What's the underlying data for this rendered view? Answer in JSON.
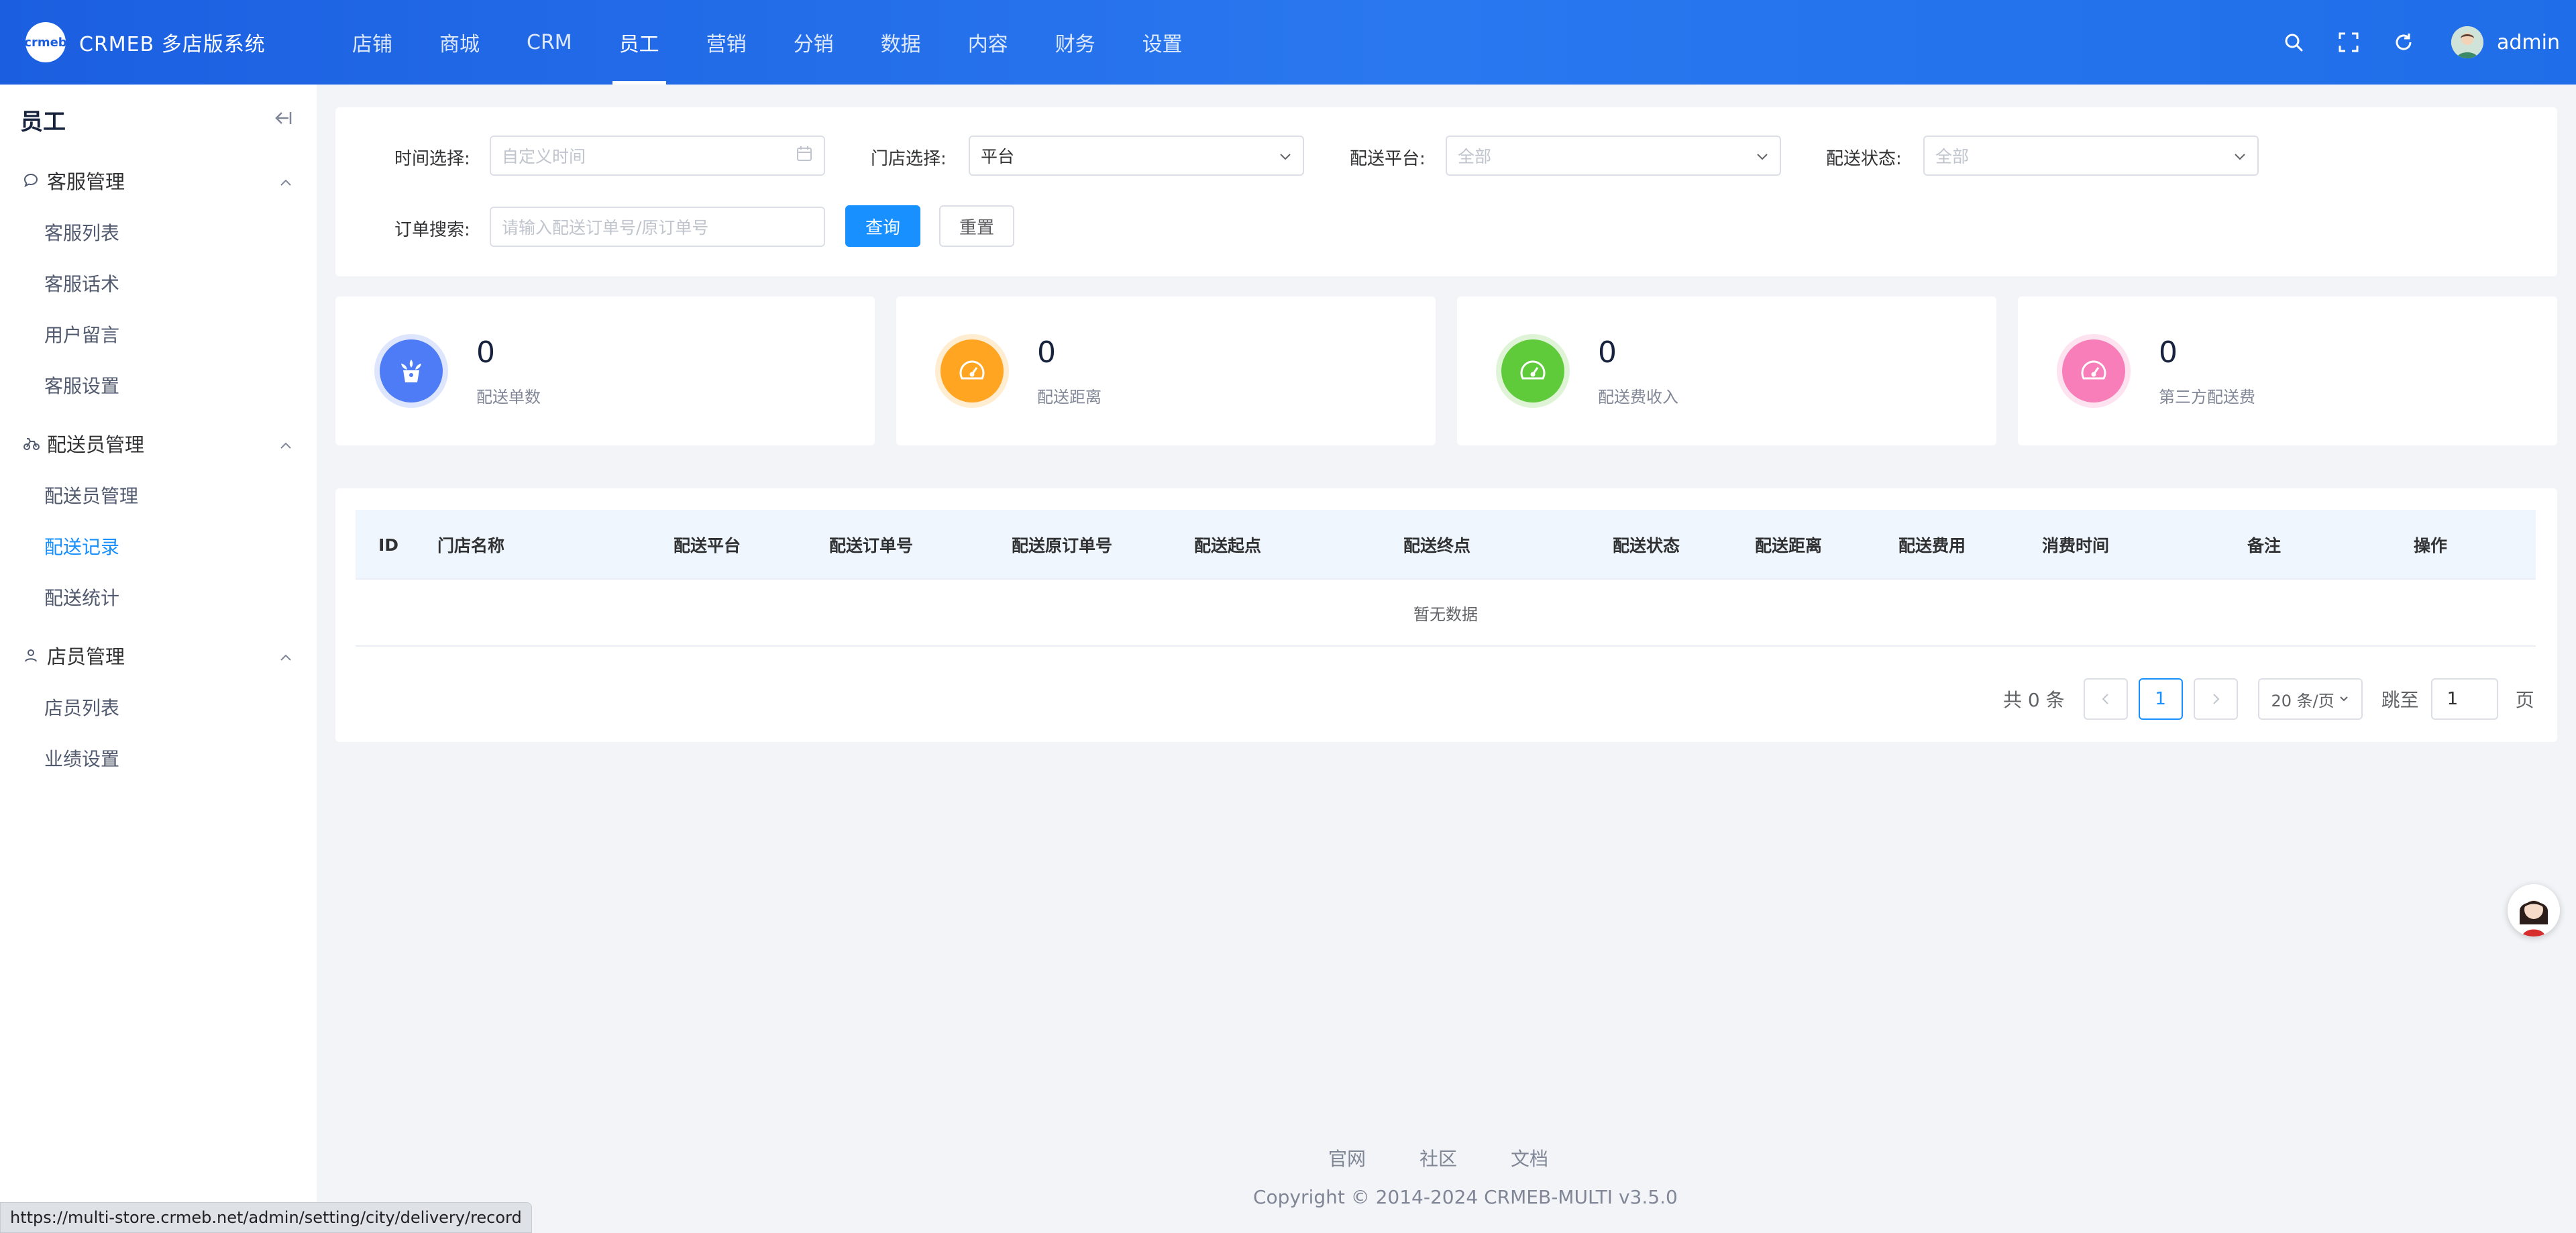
{
  "header": {
    "logo_text": "crmeb",
    "app_title": "CRMEB 多店版系统",
    "nav": [
      "店铺",
      "商城",
      "CRM",
      "员工",
      "营销",
      "分销",
      "数据",
      "内容",
      "财务",
      "设置"
    ],
    "active_nav": "员工",
    "username": "admin"
  },
  "sidebar": {
    "title": "员工",
    "groups": [
      {
        "title": "客服管理",
        "items": [
          "客服列表",
          "客服话术",
          "用户留言",
          "客服设置"
        ]
      },
      {
        "title": "配送员管理",
        "items": [
          "配送员管理",
          "配送记录",
          "配送统计"
        ]
      },
      {
        "title": "店员管理",
        "items": [
          "店员列表",
          "业绩设置"
        ]
      }
    ],
    "active_item": "配送记录"
  },
  "filters": {
    "time_label": "时间选择:",
    "time_placeholder": "自定义时间",
    "store_label": "门店选择:",
    "store_value": "平台",
    "platform_label": "配送平台:",
    "platform_placeholder": "全部",
    "status_label": "配送状态:",
    "status_placeholder": "全部",
    "search_label": "订单搜索:",
    "search_placeholder": "请输入配送订单号/原订单号",
    "query_button": "查询",
    "reset_button": "重置"
  },
  "stats": [
    {
      "value": "0",
      "label": "配送单数",
      "color": "#4e7cf6",
      "ring": "#dde6fd"
    },
    {
      "value": "0",
      "label": "配送距离",
      "color": "#ffa522",
      "ring": "#ffedd2"
    },
    {
      "value": "0",
      "label": "配送费收入",
      "color": "#5fcb3b",
      "ring": "#dff4d7"
    },
    {
      "value": "0",
      "label": "第三方配送费",
      "color": "#f77eb9",
      "ring": "#fde2ef"
    }
  ],
  "table": {
    "columns": [
      "ID",
      "门店名称",
      "配送平台",
      "配送订单号",
      "配送原订单号",
      "配送起点",
      "配送终点",
      "配送状态",
      "配送距离",
      "配送费用",
      "消费时间",
      "备注",
      "操作"
    ],
    "empty_text": "暂无数据"
  },
  "pagination": {
    "total_text": "共 0 条",
    "current_page": "1",
    "page_size": "20 条/页",
    "jump_label": "跳至",
    "jump_value": "1",
    "page_suffix": "页"
  },
  "footer": {
    "links": [
      "官网",
      "社区",
      "文档"
    ],
    "copyright": "Copyright © 2014-2024 CRMEB-MULTI v3.5.0"
  },
  "status_bar_url": "https://multi-store.crmeb.net/admin/setting/city/delivery/record"
}
